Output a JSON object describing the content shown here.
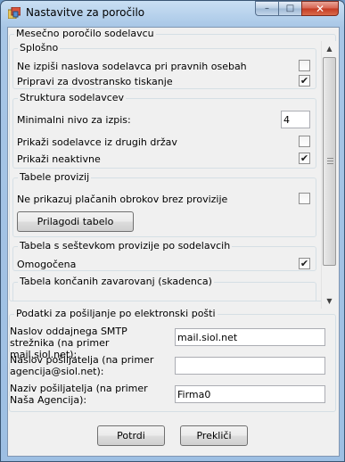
{
  "window": {
    "title": "Nastavitve za poročilo",
    "minimize_glyph": "–",
    "maximize_glyph": "□",
    "close_glyph": "✕"
  },
  "report": {
    "group_title": "Mesečno poročilo sodelavcu",
    "general": {
      "title": "Splošno",
      "hide_names_label": "Ne izpiši naslova sodelavca pri pravnih osebah",
      "hide_names_checked": false,
      "duplex_label": "Pripravi za dvostransko tiskanje",
      "duplex_checked": true
    },
    "structure": {
      "title": "Struktura sodelavcev",
      "min_level_label": "Minimalni nivo za izpis:",
      "min_level_value": "4",
      "foreign_label": "Prikaži sodelavce iz drugih držav",
      "foreign_checked": false,
      "inactive_label": "Prikaži neaktivne",
      "inactive_checked": true
    },
    "commission_tables": {
      "title": "Tabele provizij",
      "hide_unpaid_label": "Ne prikazuj plačanih obrokov brez provizije",
      "hide_unpaid_checked": false,
      "customize_button": "Prilagodi tabelo"
    },
    "sum_table": {
      "title": "Tabela s seštevkom provizije po sodelavcih",
      "enabled_label": "Omogočena",
      "enabled_checked": true
    },
    "completed_table": {
      "title": "Tabela končanih zavarovanj (skadenca)"
    }
  },
  "email": {
    "group_title": "Podatki za pošiljanje po elektronski pošti",
    "smtp_label": "Naslov oddajnega SMTP strežnika (na primer mail.siol.net):",
    "smtp_value": "mail.siol.net",
    "sender_address_label": "Naslov pošiljatelja (na primer agencija@siol.net):",
    "sender_address_value": "",
    "sender_name_label": "Naziv pošiljatelja (na primer Naša Agencija):",
    "sender_name_value": "Firma0"
  },
  "buttons": {
    "confirm": "Potrdi",
    "cancel": "Prekliči"
  },
  "check_glyph": "✔",
  "scroll_up_glyph": "▲",
  "scroll_down_glyph": "▼"
}
